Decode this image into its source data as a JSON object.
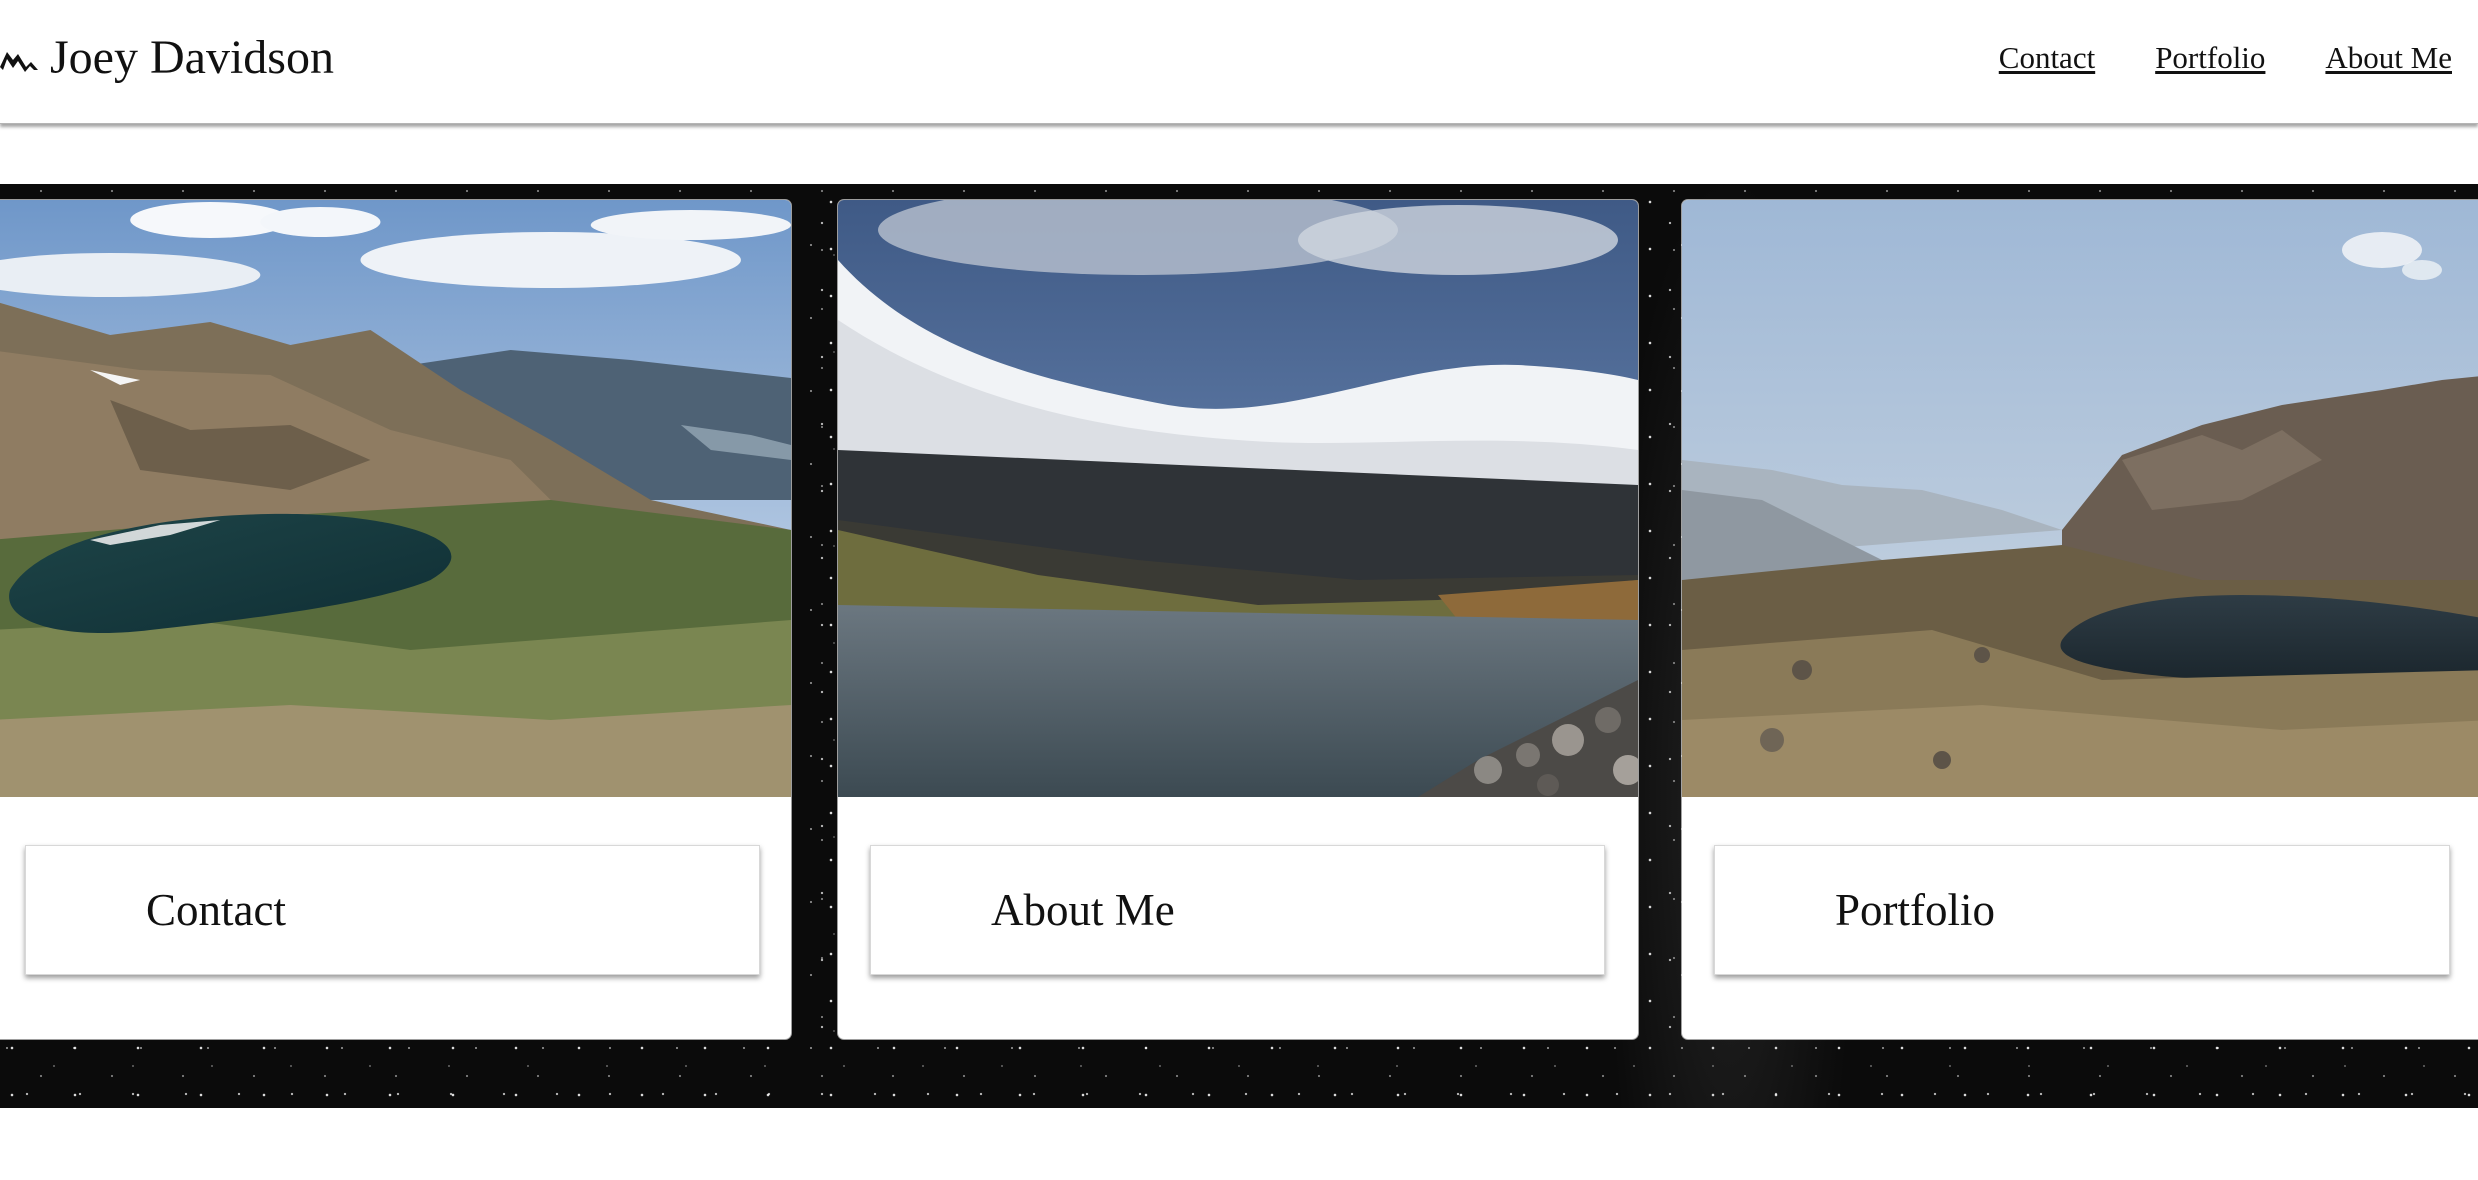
{
  "header": {
    "site_name": "Joey Davidson",
    "logo_icon": "mountain-icon",
    "nav": [
      {
        "label": "Contact"
      },
      {
        "label": "Portfolio"
      },
      {
        "label": "About Me"
      }
    ]
  },
  "cards": [
    {
      "label": "Contact",
      "image": "alpine-lake-valley-photo"
    },
    {
      "label": "About Me",
      "image": "cloud-over-lake-photo"
    },
    {
      "label": "Portfolio",
      "image": "hazy-mountain-lake-photo"
    }
  ],
  "colors": {
    "header_bg": "#ffffff",
    "band_bg": "#0b0b0b",
    "text": "#111111"
  }
}
